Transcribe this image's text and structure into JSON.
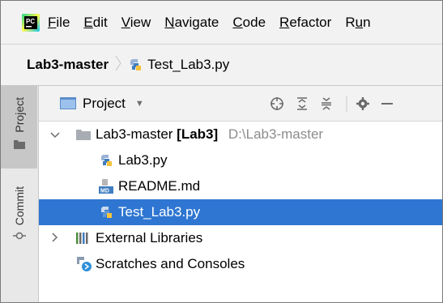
{
  "menu": {
    "items": [
      {
        "mnemonic": "F",
        "rest": "ile"
      },
      {
        "mnemonic": "E",
        "rest": "dit"
      },
      {
        "mnemonic": "V",
        "rest": "iew"
      },
      {
        "mnemonic": "N",
        "rest": "avigate"
      },
      {
        "mnemonic": "C",
        "rest": "ode"
      },
      {
        "mnemonic": "R",
        "rest": "efactor"
      },
      {
        "pre": "R",
        "mnemonic": "u",
        "rest": "n"
      }
    ]
  },
  "breadcrumb": {
    "root": "Lab3-master",
    "file": "Test_Lab3.py"
  },
  "stripe": {
    "project_label": "Project",
    "commit_label": "Commit"
  },
  "panel": {
    "title": "Project"
  },
  "tree": {
    "root_name": "Lab3-master",
    "root_module": "[Lab3]",
    "root_path": "D:\\Lab3-master",
    "files": [
      "Lab3.py",
      "README.md",
      "Test_Lab3.py"
    ],
    "external_libraries": "External Libraries",
    "scratches": "Scratches and Consoles"
  },
  "colors": {
    "selection": "#2e76d1",
    "folder": "#a8adb3",
    "python_blue": "#3f7dc0",
    "python_yellow": "#f5c33b"
  }
}
